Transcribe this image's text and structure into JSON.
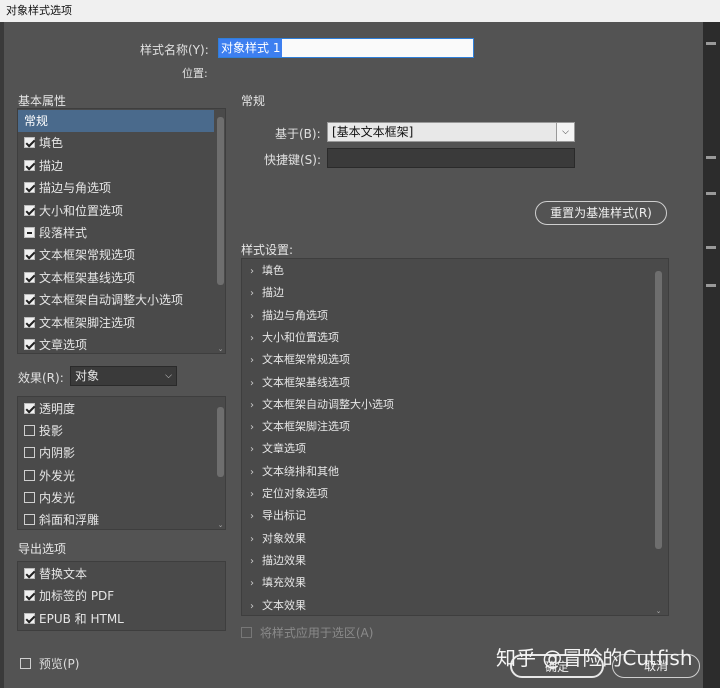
{
  "window": {
    "title": "对象样式选项"
  },
  "style_name": {
    "label": "样式名称(Y):",
    "value": "对象样式 1"
  },
  "location": {
    "label": "位置:"
  },
  "basic_attributes": {
    "heading": "基本属性",
    "items": [
      {
        "label": "常规",
        "state": "none",
        "selected": true
      },
      {
        "label": "填色",
        "state": "checked"
      },
      {
        "label": "描边",
        "state": "checked"
      },
      {
        "label": "描边与角选项",
        "state": "checked"
      },
      {
        "label": "大小和位置选项",
        "state": "checked"
      },
      {
        "label": "段落样式",
        "state": "mixed"
      },
      {
        "label": "文本框架常规选项",
        "state": "checked"
      },
      {
        "label": "文本框架基线选项",
        "state": "checked"
      },
      {
        "label": "文本框架自动调整大小选项",
        "state": "checked"
      },
      {
        "label": "文本框架脚注选项",
        "state": "checked"
      },
      {
        "label": "文章选项",
        "state": "checked"
      }
    ]
  },
  "effects": {
    "label": "效果(R):",
    "selected": "对象",
    "items": [
      {
        "label": "透明度",
        "state": "checked"
      },
      {
        "label": "投影",
        "state": "unchecked"
      },
      {
        "label": "内阴影",
        "state": "unchecked"
      },
      {
        "label": "外发光",
        "state": "unchecked"
      },
      {
        "label": "内发光",
        "state": "unchecked"
      },
      {
        "label": "斜面和浮雕",
        "state": "unchecked"
      }
    ]
  },
  "export_options": {
    "heading": "导出选项",
    "items": [
      {
        "label": "替换文本",
        "state": "checked"
      },
      {
        "label": "加标签的 PDF",
        "state": "checked"
      },
      {
        "label": "EPUB 和 HTML",
        "state": "checked"
      }
    ]
  },
  "general": {
    "heading": "常规",
    "based_on_label": "基于(B):",
    "based_on_value": "[基本文本框架]",
    "shortcut_label": "快捷键(S):",
    "shortcut_value": "",
    "reset_button": "重置为基准样式(R)"
  },
  "style_settings": {
    "heading": "样式设置:",
    "items": [
      "填色",
      "描边",
      "描边与角选项",
      "大小和位置选项",
      "文本框架常规选项",
      "文本框架基线选项",
      "文本框架自动调整大小选项",
      "文本框架脚注选项",
      "文章选项",
      "文本绕排和其他",
      "定位对象选项",
      "导出标记",
      "对象效果",
      "描边效果",
      "填充效果",
      "文本效果"
    ]
  },
  "apply_to_selection": {
    "label": "将样式应用于选区(A)"
  },
  "preview": {
    "label": "预览(P)"
  },
  "buttons": {
    "ok": "确定",
    "cancel": "取消"
  },
  "watermark": {
    "text": "知乎 @冒险的Cutfish"
  }
}
